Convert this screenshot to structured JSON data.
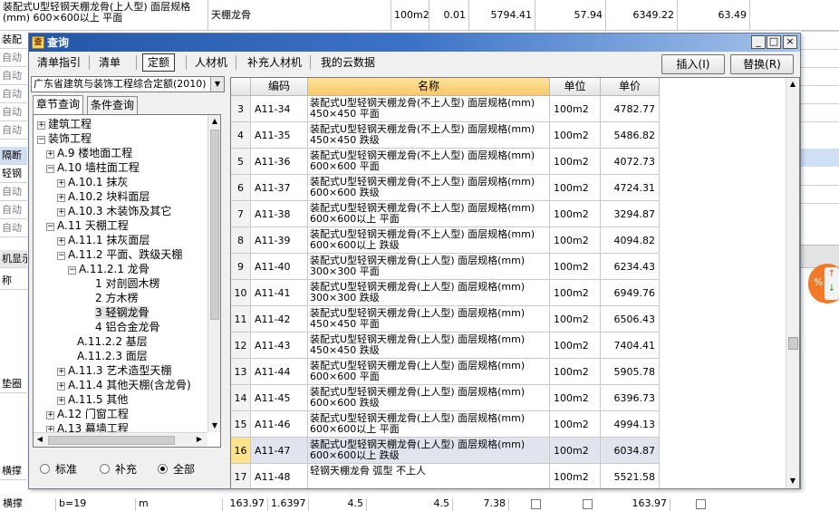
{
  "background": {
    "top_row": {
      "name": "装配式U型轻钢天棚龙骨(上人型) 面层规格(mm) 600×600以上 平面",
      "type": "天棚龙骨",
      "unit": "100m2",
      "qty": "0.01",
      "unit_price": "5794.41",
      "amount": "57.94",
      "col7": "6349.22",
      "col8": "63.49"
    },
    "left_rows": [
      "装配",
      "自动",
      "自动",
      "自动",
      "自动",
      "自动",
      "隔断",
      "轻钢",
      "自动",
      "自动",
      "自动"
    ],
    "mid_labels": [
      "机显示",
      "称"
    ],
    "lower_labels": [
      "垫圈",
      "横撑"
    ],
    "bottom_row": {
      "name": "横撑",
      "spec": "b=19",
      "unit": "m",
      "v1": "163.97",
      "v2": "1.6397",
      "v3": "4.5",
      "v4": "4.5",
      "v5": "7.38",
      "v6": "163.97"
    },
    "badge": {
      "text": "%",
      "up": "↑",
      "down": "↓"
    }
  },
  "dialog": {
    "title": "查询",
    "app_icon": "查",
    "window_buttons": {
      "minimize": "_",
      "restore": "□",
      "close": "×"
    },
    "tabs": [
      "清单指引",
      "清单",
      "定额",
      "人材机",
      "补充人材机",
      "我的云数据"
    ],
    "active_tab": "定额",
    "insert_button": "插入(I)",
    "replace_button": "替换(R)",
    "library": "广东省建筑与装饰工程综合定额(2010)",
    "left_tabs": [
      "章节查询",
      "条件查询"
    ],
    "active_left_tab": "章节查询",
    "tree": [
      {
        "toggle": "+",
        "label": "建筑工程"
      },
      {
        "toggle": "−",
        "label": "装饰工程"
      },
      {
        "toggle": "+",
        "label": "A.9 楼地面工程"
      },
      {
        "toggle": "−",
        "label": "A.10 墙柱面工程"
      },
      {
        "toggle": "+",
        "label": "A.10.1 抹灰"
      },
      {
        "toggle": "+",
        "label": "A.10.2 块料面层"
      },
      {
        "toggle": "+",
        "label": "A.10.3 木装饰及其它"
      },
      {
        "toggle": "−",
        "label": "A.11 天棚工程"
      },
      {
        "toggle": "+",
        "label": "A.11.1 抹灰面层"
      },
      {
        "toggle": "−",
        "label": "A.11.2 平面、跌级天棚"
      },
      {
        "toggle": "−",
        "label": "A.11.2.1 龙骨"
      },
      {
        "toggle": "",
        "label": "1 对剖圆木楞"
      },
      {
        "toggle": "",
        "label": "2 方木楞"
      },
      {
        "toggle": "",
        "label": "3 轻钢龙骨"
      },
      {
        "toggle": "",
        "label": "4 铝合金龙骨"
      },
      {
        "toggle": "",
        "label": "A.11.2.2 基层"
      },
      {
        "toggle": "",
        "label": "A.11.2.3 面层"
      },
      {
        "toggle": "+",
        "label": "A.11.3 艺术造型天棚"
      },
      {
        "toggle": "+",
        "label": "A.11.4 其他天棚(含龙骨)"
      },
      {
        "toggle": "+",
        "label": "A.11.5 其他"
      },
      {
        "toggle": "+",
        "label": "A.12 门窗工程"
      },
      {
        "toggle": "+",
        "label": "A.13 幕墙工程"
      }
    ],
    "selected_tree_item": "3 轻钢龙骨",
    "radios": [
      "标准",
      "补充",
      "全部"
    ],
    "selected_radio": "全部",
    "grid": {
      "columns": [
        "编码",
        "名称",
        "单位",
        "单价"
      ],
      "rows": [
        {
          "idx": "3",
          "code": "A11-34",
          "name": "装配式U型轻钢天棚龙骨(不上人型) 面层规格(mm) 450×450 平面",
          "unit": "100m2",
          "price": "4782.77"
        },
        {
          "idx": "4",
          "code": "A11-35",
          "name": "装配式U型轻钢天棚龙骨(不上人型) 面层规格(mm) 450×450 跌级",
          "unit": "100m2",
          "price": "5486.82"
        },
        {
          "idx": "5",
          "code": "A11-36",
          "name": "装配式U型轻钢天棚龙骨(不上人型) 面层规格(mm) 600×600 平面",
          "unit": "100m2",
          "price": "4072.73"
        },
        {
          "idx": "6",
          "code": "A11-37",
          "name": "装配式U型轻钢天棚龙骨(不上人型) 面层规格(mm) 600×600 跌级",
          "unit": "100m2",
          "price": "4724.31"
        },
        {
          "idx": "7",
          "code": "A11-38",
          "name": "装配式U型轻钢天棚龙骨(不上人型) 面层规格(mm) 600×600以上 平面",
          "unit": "100m2",
          "price": "3294.87"
        },
        {
          "idx": "8",
          "code": "A11-39",
          "name": "装配式U型轻钢天棚龙骨(不上人型) 面层规格(mm) 600×600以上 跌级",
          "unit": "100m2",
          "price": "4094.82"
        },
        {
          "idx": "9",
          "code": "A11-40",
          "name": "装配式U型轻钢天棚龙骨(上人型) 面层规格(mm) 300×300 平面",
          "unit": "100m2",
          "price": "6234.43"
        },
        {
          "idx": "10",
          "code": "A11-41",
          "name": "装配式U型轻钢天棚龙骨(上人型) 面层规格(mm) 300×300 跌级",
          "unit": "100m2",
          "price": "6949.76"
        },
        {
          "idx": "11",
          "code": "A11-42",
          "name": "装配式U型轻钢天棚龙骨(上人型) 面层规格(mm) 450×450 平面",
          "unit": "100m2",
          "price": "6506.43"
        },
        {
          "idx": "12",
          "code": "A11-43",
          "name": "装配式U型轻钢天棚龙骨(上人型) 面层规格(mm) 450×450 跌级",
          "unit": "100m2",
          "price": "7404.41"
        },
        {
          "idx": "13",
          "code": "A11-44",
          "name": "装配式U型轻钢天棚龙骨(上人型) 面层规格(mm) 600×600 平面",
          "unit": "100m2",
          "price": "5905.78"
        },
        {
          "idx": "14",
          "code": "A11-45",
          "name": "装配式U型轻钢天棚龙骨(上人型) 面层规格(mm) 600×600 跌级",
          "unit": "100m2",
          "price": "6396.73"
        },
        {
          "idx": "15",
          "code": "A11-46",
          "name": "装配式U型轻钢天棚龙骨(上人型) 面层规格(mm) 600×600以上 平面",
          "unit": "100m2",
          "price": "4994.13"
        },
        {
          "idx": "16",
          "code": "A11-47",
          "name": "装配式U型轻钢天棚龙骨(上人型) 面层规格(mm) 600×600以上 跌级",
          "unit": "100m2",
          "price": "6034.87"
        },
        {
          "idx": "17",
          "code": "A11-48",
          "name": "轻钢天棚龙骨 弧型 不上人",
          "unit": "100m2",
          "price": "5521.58"
        }
      ],
      "selected_row": "16"
    }
  },
  "colors": {
    "title_bar": "#2456a8",
    "header_highlight": "#f8c869",
    "selected_index": "#fde38c",
    "badge": "#f07a2a"
  }
}
